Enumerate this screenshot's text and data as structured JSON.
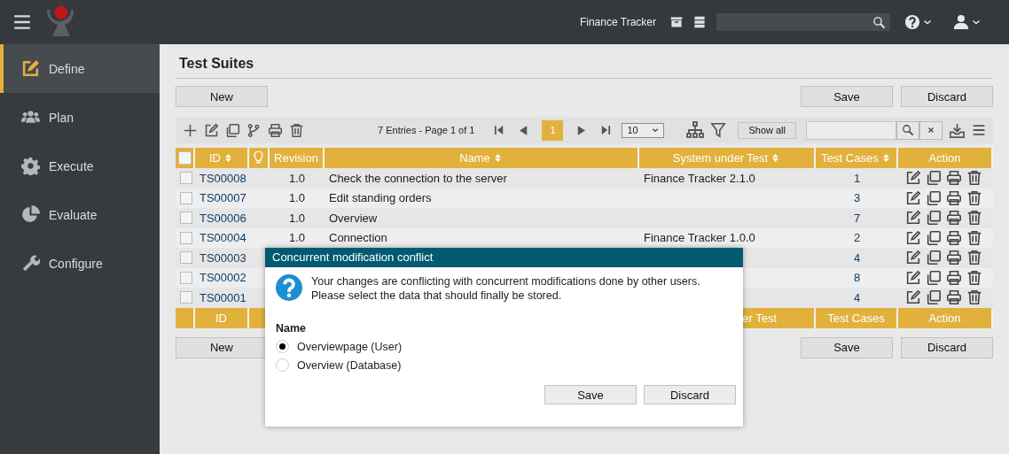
{
  "topbar": {
    "project": "Finance Tracker"
  },
  "sidebar": {
    "items": [
      {
        "label": "Define",
        "kind": "define",
        "selected": true
      },
      {
        "label": "Plan",
        "kind": "plan",
        "selected": false
      },
      {
        "label": "Execute",
        "kind": "execute",
        "selected": false
      },
      {
        "label": "Evaluate",
        "kind": "evaluate",
        "selected": false
      },
      {
        "label": "Configure",
        "kind": "configure",
        "selected": false
      }
    ]
  },
  "page": {
    "title": "Test Suites",
    "top_buttons": [
      "New",
      "Save",
      "Discard"
    ],
    "bottom_buttons": [
      "New",
      "Save",
      "Discard"
    ]
  },
  "toolbar": {
    "entries": "7 Entries - Page 1 of 1",
    "pages": [
      {
        "label": "1",
        "selected": true
      }
    ],
    "page_size": "10",
    "show_all": "Show all"
  },
  "table": {
    "columns": [
      {
        "kind": "checkbox",
        "checked": false
      },
      {
        "kind": "text",
        "label": "ID",
        "sortable": true
      },
      {
        "kind": "bulb"
      },
      {
        "kind": "text",
        "label": "Revision",
        "sortable": false
      },
      {
        "kind": "text",
        "label": "Name",
        "sortable": true
      },
      {
        "kind": "text",
        "label": "System under Test",
        "sortable": true
      },
      {
        "kind": "text",
        "label": "Test Cases",
        "sortable": true
      },
      {
        "kind": "text",
        "label": "Action",
        "sortable": false
      }
    ],
    "rows": [
      {
        "id": "TS00008",
        "revision": "1.0",
        "name": "Check the connection to the server",
        "system": "Finance Tracker 2.1.0",
        "test_cases": "1",
        "checked": false
      },
      {
        "id": "TS00007",
        "revision": "1.0",
        "name": "Edit standing orders",
        "test_cases": "3",
        "checked": false
      },
      {
        "id": "TS00006",
        "revision": "1.0",
        "name": "Overview",
        "test_cases": "7",
        "checked": false
      },
      {
        "id": "TS00004",
        "revision": "1.0",
        "name": "Connection",
        "system": "Finance Tracker 1.0.0",
        "test_cases": "2",
        "checked": false
      },
      {
        "id": "TS00003",
        "test_cases": "4",
        "checked": false
      },
      {
        "id": "TS00002",
        "test_cases": "8",
        "checked": false
      },
      {
        "id": "TS00001",
        "test_cases": "4",
        "checked": false
      }
    ],
    "footer": {
      "id": "ID",
      "system": "er Test",
      "test_cases": "Test Cases",
      "action": "Action"
    }
  },
  "dialog": {
    "title": "Concurrent modification conflict",
    "message": "Your changes are conflicting with concurrent modifications done by other users.\nPlease select the data that should finally be stored.",
    "field_label": "Name",
    "options": [
      {
        "label": "Overviewpage (User)",
        "selected": true
      },
      {
        "label": "Overview (Database)",
        "selected": false
      }
    ],
    "buttons": [
      "Save",
      "Discard"
    ]
  }
}
